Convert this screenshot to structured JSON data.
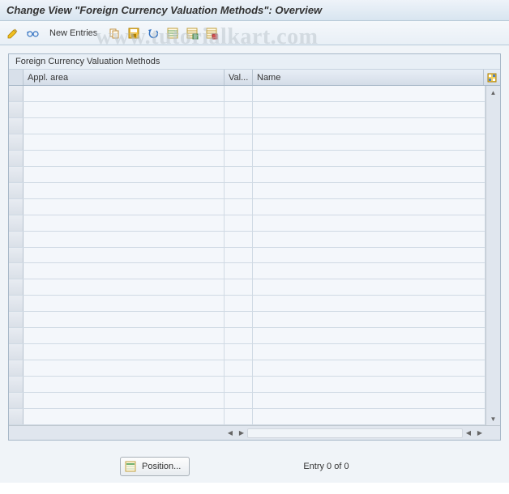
{
  "title": "Change View \"Foreign Currency Valuation Methods\": Overview",
  "watermark": "www.tutorialkart.com",
  "toolbar": {
    "new_entries_label": "New Entries"
  },
  "table": {
    "title": "Foreign Currency Valuation Methods",
    "columns": {
      "appl_area": "Appl. area",
      "val": "Val...",
      "name": "Name"
    },
    "row_count": 21
  },
  "footer": {
    "position_label": "Position...",
    "entry_text": "Entry 0 of 0"
  }
}
